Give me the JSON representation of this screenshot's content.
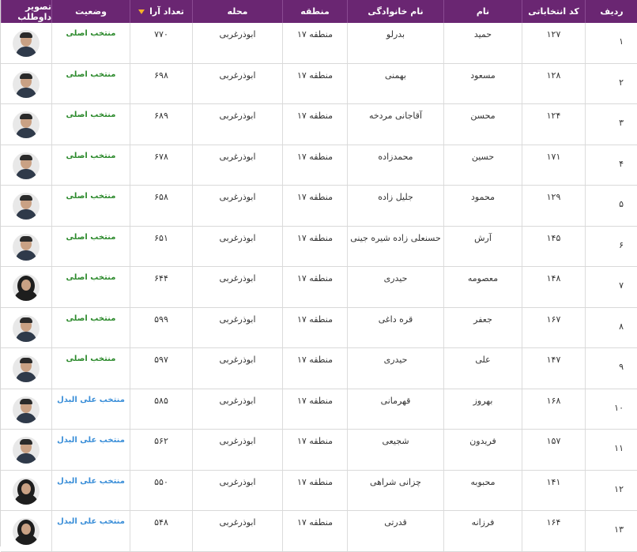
{
  "headers": {
    "rank": "ردیف",
    "code": "کد انتخاباتی",
    "first": "نام",
    "last": "نام خانوادگی",
    "zone": "منطقه",
    "area": "محله",
    "votes": "تعداد آرا",
    "status": "وضعیت",
    "photo": "تصویر داوطلب"
  },
  "colors": {
    "header_bg": "#6a2672",
    "status_main": "#2e8b2e",
    "status_alt": "#3a8ed8",
    "sort_arrow": "#f5b227"
  },
  "icons": {
    "sort": "sort-desc-icon",
    "photo": "candidate-avatar-icon"
  },
  "rows": [
    {
      "rank": "۱",
      "code": "۱۲۷",
      "first": "حمید",
      "last": "بدرلو",
      "zone": "منطقه ۱۷",
      "area": "ابوذرغربی",
      "votes": "۷۷۰",
      "status": "منتخب اصلی",
      "status_type": "main",
      "gender": "m"
    },
    {
      "rank": "۲",
      "code": "۱۲۸",
      "first": "مسعود",
      "last": "بهمنی",
      "zone": "منطقه ۱۷",
      "area": "ابوذرغربی",
      "votes": "۶۹۸",
      "status": "منتخب اصلی",
      "status_type": "main",
      "gender": "m"
    },
    {
      "rank": "۳",
      "code": "۱۲۴",
      "first": "محسن",
      "last": "آقاجانی مردخه",
      "zone": "منطقه ۱۷",
      "area": "ابوذرغربی",
      "votes": "۶۸۹",
      "status": "منتخب اصلی",
      "status_type": "main",
      "gender": "m"
    },
    {
      "rank": "۴",
      "code": "۱۷۱",
      "first": "حسین",
      "last": "محمدزاده",
      "zone": "منطقه ۱۷",
      "area": "ابوذرغربی",
      "votes": "۶۷۸",
      "status": "منتخب اصلی",
      "status_type": "main",
      "gender": "m"
    },
    {
      "rank": "۵",
      "code": "۱۲۹",
      "first": "محمود",
      "last": "جلیل زاده",
      "zone": "منطقه ۱۷",
      "area": "ابوذرغربی",
      "votes": "۶۵۸",
      "status": "منتخب اصلی",
      "status_type": "main",
      "gender": "m"
    },
    {
      "rank": "۶",
      "code": "۱۴۵",
      "first": "آرش",
      "last": "حسنعلی زاده شیره جینی",
      "zone": "منطقه ۱۷",
      "area": "ابوذرغربی",
      "votes": "۶۵۱",
      "status": "منتخب اصلی",
      "status_type": "main",
      "gender": "m"
    },
    {
      "rank": "۷",
      "code": "۱۴۸",
      "first": "معصومه",
      "last": "حیدری",
      "zone": "منطقه ۱۷",
      "area": "ابوذرغربی",
      "votes": "۶۴۴",
      "status": "منتخب اصلی",
      "status_type": "main",
      "gender": "f"
    },
    {
      "rank": "۸",
      "code": "۱۶۷",
      "first": "جعفر",
      "last": "قره داغی",
      "zone": "منطقه ۱۷",
      "area": "ابوذرغربی",
      "votes": "۵۹۹",
      "status": "منتخب اصلی",
      "status_type": "main",
      "gender": "m"
    },
    {
      "rank": "۹",
      "code": "۱۴۷",
      "first": "علی",
      "last": "حیدری",
      "zone": "منطقه ۱۷",
      "area": "ابوذرغربی",
      "votes": "۵۹۷",
      "status": "منتخب اصلی",
      "status_type": "main",
      "gender": "m"
    },
    {
      "rank": "۱۰",
      "code": "۱۶۸",
      "first": "بهروز",
      "last": "قهرمانی",
      "zone": "منطقه ۱۷",
      "area": "ابوذرغربی",
      "votes": "۵۸۵",
      "status": "منتخب علی البدل",
      "status_type": "alt",
      "gender": "m"
    },
    {
      "rank": "۱۱",
      "code": "۱۵۷",
      "first": "فریدون",
      "last": "شجیعی",
      "zone": "منطقه ۱۷",
      "area": "ابوذرغربی",
      "votes": "۵۶۲",
      "status": "منتخب علی البدل",
      "status_type": "alt",
      "gender": "m"
    },
    {
      "rank": "۱۲",
      "code": "۱۴۱",
      "first": "محبوبه",
      "last": "چزانی شراهی",
      "zone": "منطقه ۱۷",
      "area": "ابوذرغربی",
      "votes": "۵۵۰",
      "status": "منتخب علی البدل",
      "status_type": "alt",
      "gender": "f"
    },
    {
      "rank": "۱۳",
      "code": "۱۶۴",
      "first": "فرزانه",
      "last": "قدرتی",
      "zone": "منطقه ۱۷",
      "area": "ابوذرغربی",
      "votes": "۵۴۸",
      "status": "منتخب علی البدل",
      "status_type": "alt",
      "gender": "f"
    }
  ]
}
